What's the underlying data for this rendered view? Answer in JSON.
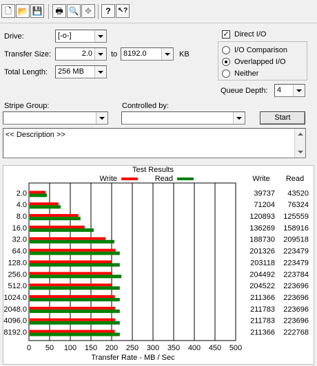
{
  "toolbar": {
    "buttons": [
      {
        "icon": "new-document-icon",
        "glyph": "🗋"
      },
      {
        "icon": "open-folder-icon",
        "glyph": "📂"
      },
      {
        "icon": "save-disk-icon",
        "glyph": "💾"
      },
      {
        "icon": "print-icon",
        "glyph": "🖶"
      },
      {
        "icon": "print-preview-icon",
        "glyph": "🔍"
      },
      {
        "icon": "move-icon",
        "glyph": "✥"
      },
      {
        "icon": "help-icon",
        "glyph": "?"
      },
      {
        "icon": "context-help-icon",
        "glyph": "↖?"
      }
    ]
  },
  "settings": {
    "drive_label": "Drive:",
    "drive_value": "[-o-]",
    "transfer_size_label": "Transfer Size:",
    "transfer_from": "2.0",
    "to_label": "to",
    "transfer_to": "8192.0",
    "unit_label": "KB",
    "total_length_label": "Total Length:",
    "total_length_value": "256 MB",
    "direct_io_label": "Direct I/O",
    "direct_io_checked": true,
    "io_modes": [
      {
        "label": "I/O Comparison",
        "selected": false
      },
      {
        "label": "Overlapped I/O",
        "selected": true
      },
      {
        "label": "Neither",
        "selected": false
      }
    ],
    "queue_depth_label": "Queue Depth:",
    "queue_depth_value": "4",
    "stripe_group_label": "Stripe Group:",
    "stripe_group_value": "",
    "controlled_by_label": "Controlled by:",
    "controlled_by_value": "",
    "start_label": "Start",
    "description": "<< Description >>"
  },
  "results": {
    "title": "Test Results",
    "write_legend": "Write",
    "read_legend": "Read",
    "write_color": "#ff0000",
    "read_color": "#008000",
    "col_write": "Write",
    "col_read": "Read"
  },
  "chart_data": {
    "type": "bar",
    "orientation": "horizontal",
    "title": "Test Results",
    "xlabel": "Transfer Rate - MB / Sec",
    "xlim": [
      0,
      500
    ],
    "xticks": [
      "0",
      "50",
      "100",
      "150",
      "200",
      "250",
      "300",
      "350",
      "400",
      "450",
      "500"
    ],
    "categories": [
      "2.0",
      "4.0",
      "8.0",
      "16.0",
      "32.0",
      "64.0",
      "128.0",
      "256.0",
      "512.0",
      "1024.0",
      "2048.0",
      "4096.0",
      "8192.0"
    ],
    "series": [
      {
        "name": "Write",
        "color": "#ff0000",
        "values": [
          39,
          70,
          118,
          133,
          184,
          208,
          198,
          200,
          200,
          206,
          207,
          207,
          206
        ],
        "labels": [
          "39737",
          "71204",
          "120893",
          "136269",
          "188730",
          "201326",
          "203118",
          "204492",
          "204522",
          "211366",
          "211783",
          "211783",
          "211366"
        ]
      },
      {
        "name": "Read",
        "color": "#008000",
        "values": [
          42,
          75,
          123,
          155,
          205,
          218,
          218,
          222,
          218,
          218,
          218,
          218,
          218
        ],
        "labels": [
          "43520",
          "76324",
          "125559",
          "158916",
          "209518",
          "223479",
          "223479",
          "223784",
          "223696",
          "223696",
          "223696",
          "223696",
          "222768"
        ]
      }
    ],
    "grid": true
  }
}
